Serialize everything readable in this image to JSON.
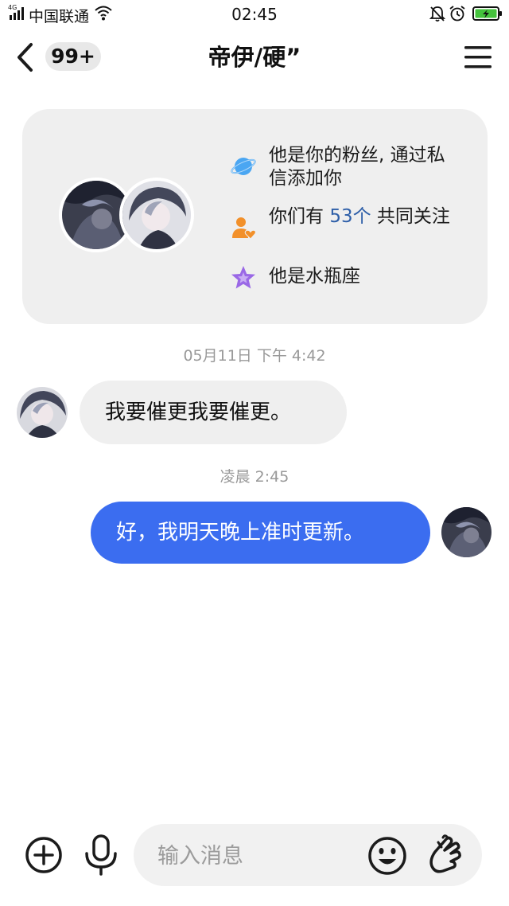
{
  "status_bar": {
    "network": "4G",
    "carrier": "中国联通",
    "time": "02:45"
  },
  "header": {
    "unread_count": "99+",
    "title": "帝伊/硬”"
  },
  "info_card": {
    "rows": [
      {
        "icon": "planet-icon",
        "text": "他是你的粉丝, 通过私信添加你"
      },
      {
        "icon": "mutual-follow-icon",
        "text_before": "你们有",
        "highlight": "53个",
        "text_after": " 共同关注"
      },
      {
        "icon": "star-icon",
        "text": "他是水瓶座"
      }
    ]
  },
  "messages": [
    {
      "timestamp": "05月11日 下午 4:42",
      "direction": "incoming",
      "text": "我要催更我要催更。"
    },
    {
      "timestamp": "凌晨 2:45",
      "direction": "outgoing",
      "text": "好，我明天晚上准时更新。"
    }
  ],
  "composer": {
    "placeholder": "输入消息"
  },
  "colors": {
    "accent_bubble": "#3b6df0",
    "incoming_bubble": "#efefef",
    "card_bg": "#efefef",
    "highlight_text": "#2d5ea8",
    "planet_icon": "#4aa6f2",
    "mutual_icon": "#f2902a",
    "star_icon": "#9a68e6"
  }
}
